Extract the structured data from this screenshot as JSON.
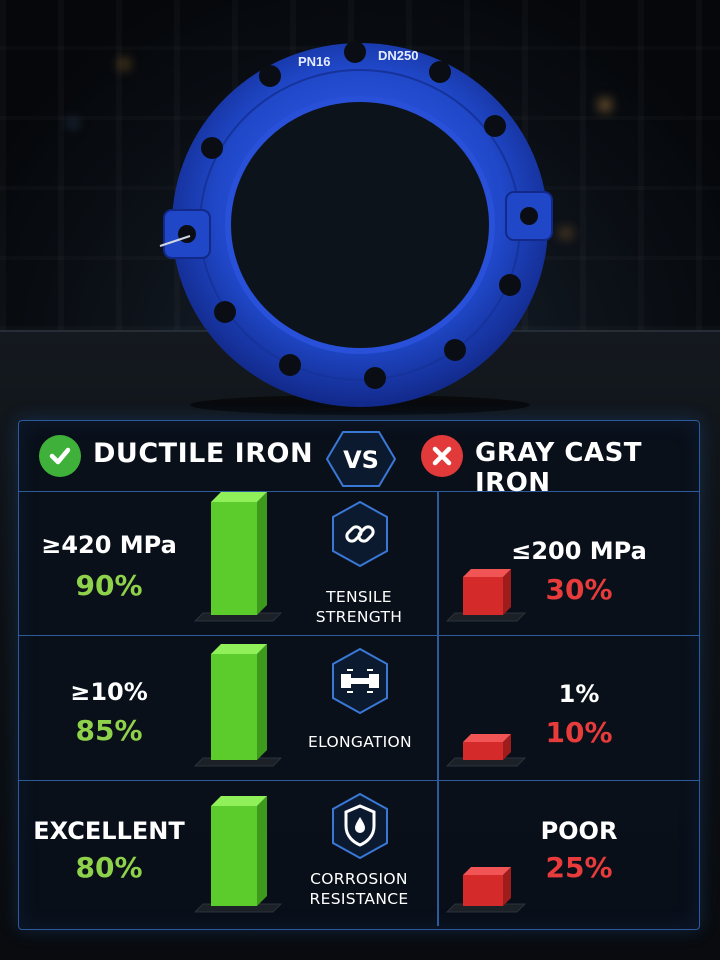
{
  "flange": {
    "stamp_left": "PN16",
    "stamp_right": "DN250",
    "color": "#1f47c7"
  },
  "header": {
    "left_title": "DUCTILE IRON",
    "left_icon": "check-circle-icon",
    "center_label": "VS",
    "right_title": "GRAY CAST IRON",
    "right_icon": "x-circle-icon"
  },
  "colors": {
    "panel_border": "#2c5a9a",
    "positive": "#8ed14a",
    "negative": "#e83b3b",
    "bar_green": "#5ccc2c",
    "bar_red": "#d42a2a"
  },
  "rows": [
    {
      "metric": "TENSILE STRENGTH",
      "metric_icon": "chain-link-icon",
      "ductile_value": "≥420 MPa",
      "ductile_pct": "90%",
      "ductile_level": 0.9,
      "gray_value": "≤200 MPa",
      "gray_pct": "30%",
      "gray_level": 0.3
    },
    {
      "metric": "ELONGATION",
      "metric_icon": "stretch-bar-icon",
      "ductile_value": "≥10%",
      "ductile_pct": "85%",
      "ductile_level": 0.85,
      "gray_value": "1%",
      "gray_pct": "10%",
      "gray_level": 0.1
    },
    {
      "metric": "CORROSION RESISTANCE",
      "metric_icon": "shield-drop-icon",
      "ductile_value": "EXCELLENT",
      "ductile_pct": "80%",
      "ductile_level": 0.8,
      "gray_value": "POOR",
      "gray_pct": "25%",
      "gray_level": 0.25
    }
  ]
}
